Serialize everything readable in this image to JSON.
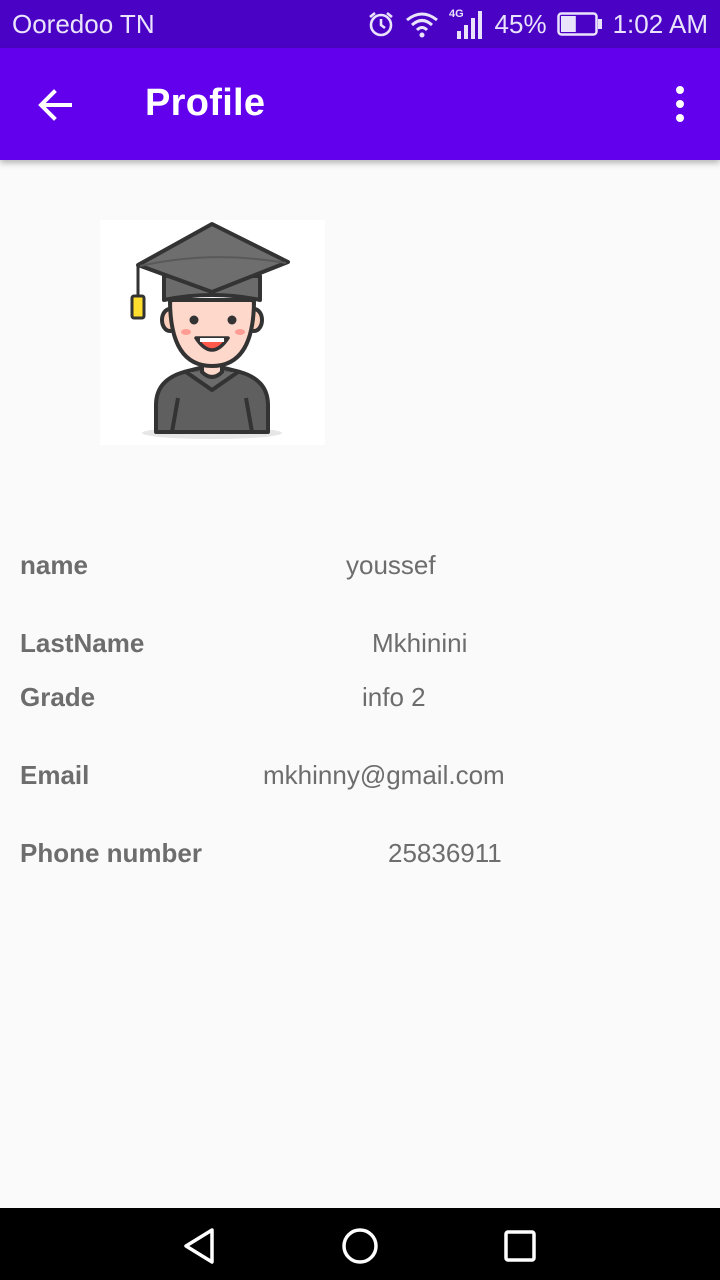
{
  "status_bar": {
    "carrier": "Ooredoo TN",
    "network_type": "4G",
    "battery_percent": "45%",
    "battery_level": 0.45,
    "time": "1:02 AM",
    "icons": [
      "alarm-icon",
      "wifi-icon",
      "signal-icon",
      "battery-icon"
    ]
  },
  "app_bar": {
    "title": "Profile",
    "back_icon": "arrow-left-icon",
    "menu_icon": "more-vert-icon",
    "color": "#6200ee"
  },
  "avatar": {
    "icon": "graduate-avatar-icon"
  },
  "profile": {
    "name": {
      "label": "name",
      "value": "youssef"
    },
    "last_name": {
      "label": "LastName",
      "value": "Mkhinini"
    },
    "grade": {
      "label": "Grade",
      "value": "info 2"
    },
    "email": {
      "label": "Email",
      "value": "mkhinny@gmail.com"
    },
    "phone": {
      "label": "Phone number",
      "value": "25836911"
    }
  },
  "nav_bar": {
    "icons": [
      "back-triangle-icon",
      "home-circle-icon",
      "recents-square-icon"
    ]
  }
}
